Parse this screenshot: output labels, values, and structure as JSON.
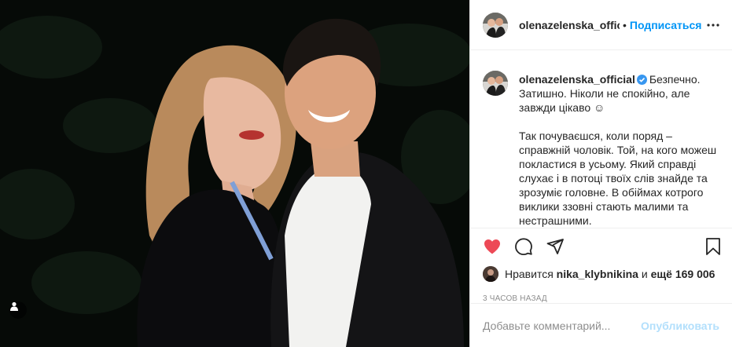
{
  "post": {
    "username": "olenazelenska_offic",
    "follow_label": "Подписаться",
    "dot": "•",
    "more_icon": "more-horizontal-icon"
  },
  "caption": {
    "username": "olenazelenska_official",
    "paragraph_1": "Безпечно. Затишно. Ніколи не спокійно, але завжди цікаво ☺",
    "paragraph_2": "Так почуваєшся, коли поряд – справжній чоловік. Той, на кого можеш покластися в усьому. Який справді слухає і в потоці твоїх слів знайде та зрозуміє головне. В обіймах котрого виклики ззовні стають малими та нестрашними."
  },
  "actions": {
    "like_icon": "heart-filled-icon",
    "comment_icon": "comment-icon",
    "share_icon": "share-icon",
    "save_icon": "bookmark-icon",
    "like_color": "#ed4956"
  },
  "likes": {
    "prefix": "Нравится",
    "user": "nika_klybnikina",
    "conj": "и",
    "others": "ещё 169 006"
  },
  "timestamp": "3 часов назад",
  "comment": {
    "placeholder": "Добавьте комментарий...",
    "post_label": "Опубликовать"
  },
  "colors": {
    "accent": "#0095f6",
    "post_disabled": "#b2dffc",
    "photo_bg": "#050806"
  }
}
